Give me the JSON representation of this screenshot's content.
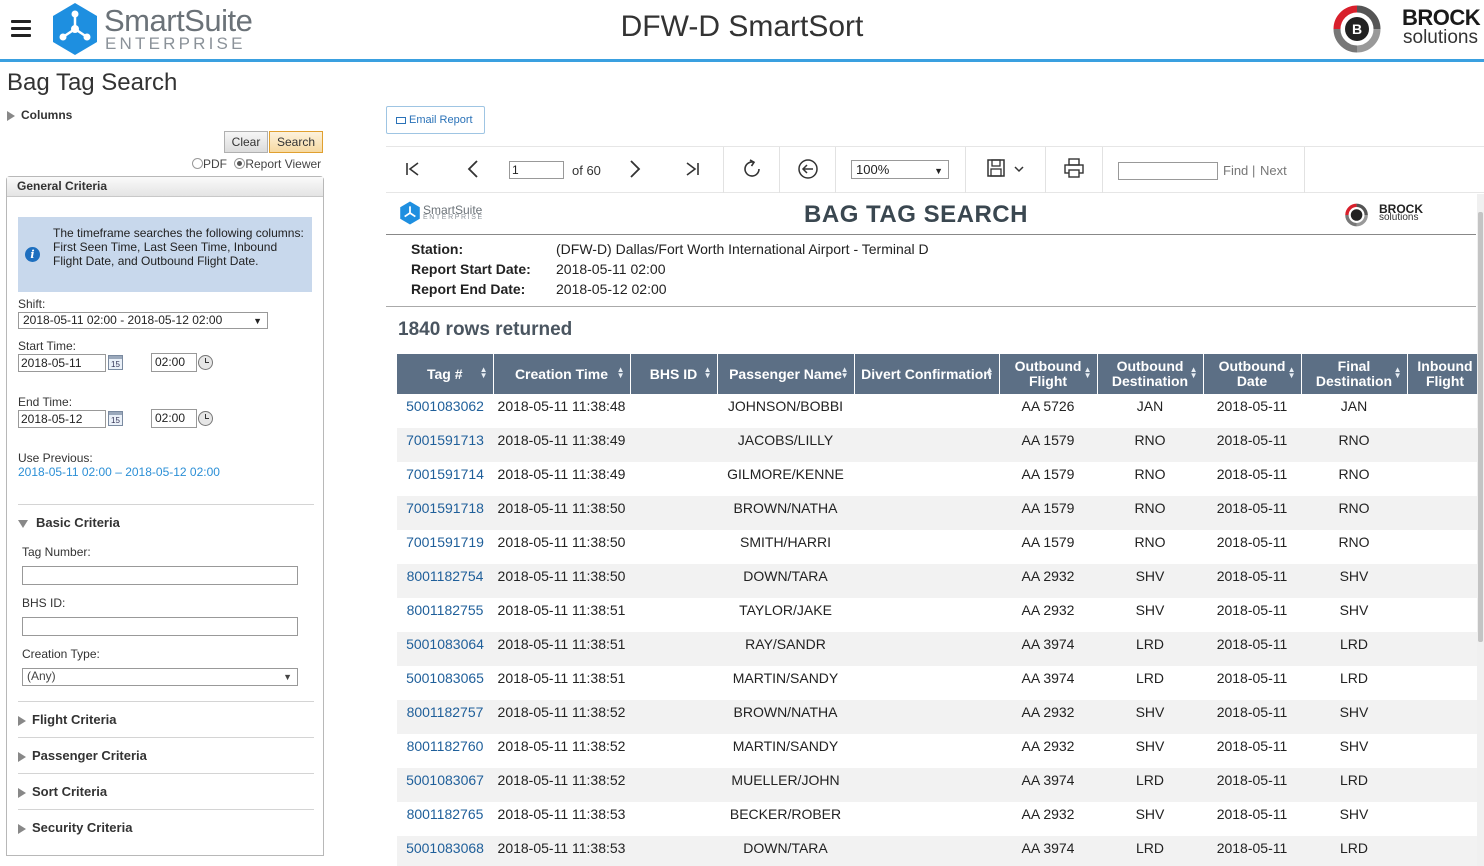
{
  "header": {
    "app_logo_name": "SmartSuite",
    "app_logo_sub": "ENTERPRISE",
    "title": "DFW-D SmartSort",
    "vendor_name": "BROCK",
    "vendor_sub": "solutions"
  },
  "sidebar": {
    "page_title": "Bag Tag Search",
    "columns_label": "Columns",
    "clear_label": "Clear",
    "search_label": "Search",
    "pdf_label": "PDF",
    "viewer_label": "Report Viewer",
    "output_selected": "Report Viewer",
    "general_criteria_label": "General Criteria",
    "info_text": "The timeframe searches the following columns: First Seen Time, Last Seen Time, Inbound Flight Date, and Outbound Flight Date.",
    "shift_label": "Shift:",
    "shift_value": "2018-05-11 02:00 - 2018-05-12 02:00",
    "start_time_label": "Start Time:",
    "start_date": "2018-05-11",
    "start_hour": "02:00",
    "end_time_label": "End Time:",
    "end_date": "2018-05-12",
    "end_hour": "02:00",
    "calendar_day": "15",
    "use_previous_label": "Use Previous:",
    "use_previous_link": "2018-05-11 02:00 – 2018-05-12 02:00",
    "basic_criteria_label": "Basic Criteria",
    "tag_number_label": "Tag Number:",
    "tag_number_value": "",
    "bhs_id_label": "BHS ID:",
    "bhs_id_value": "",
    "creation_type_label": "Creation Type:",
    "creation_type_value": "(Any)",
    "flight_criteria_label": "Flight Criteria",
    "passenger_criteria_label": "Passenger Criteria",
    "sort_criteria_label": "Sort Criteria",
    "security_criteria_label": "Security Criteria"
  },
  "viewer": {
    "email_label": "Email Report",
    "page_current": "1",
    "page_total_label": "of 60",
    "zoom": "100%",
    "find_value": "",
    "find_label": "Find",
    "find_sep": "|",
    "next_label": "Next"
  },
  "report": {
    "logo_name": "SmartSuite",
    "logo_sub": "ENTERPRISE",
    "title": "BAG TAG SEARCH",
    "brock_name": "BROCK",
    "brock_sub": "solutions",
    "station_key": "Station:",
    "station_val": "(DFW-D) Dallas/Fort Worth International Airport - Terminal D",
    "start_key": "Report Start Date:",
    "start_val": "2018-05-11 02:00",
    "end_key": "Report End Date:",
    "end_val": "2018-05-12 02:00",
    "rows_returned": "1840 rows returned",
    "columns": [
      "Tag #",
      "Creation Time",
      "BHS ID",
      "Passenger Name",
      "Divert Confirmation",
      "Outbound Flight",
      "Outbound Destination",
      "Outbound Date",
      "Final Destination",
      "Inbound Flight"
    ],
    "rows": [
      [
        "5001083062",
        "2018-05-11 11:38:48",
        "",
        "JOHNSON/BOBBI",
        "",
        "AA 5726",
        "JAN",
        "2018-05-11",
        "JAN",
        ""
      ],
      [
        "7001591713",
        "2018-05-11 11:38:49",
        "",
        "JACOBS/LILLY",
        "",
        "AA 1579",
        "RNO",
        "2018-05-11",
        "RNO",
        ""
      ],
      [
        "7001591714",
        "2018-05-11 11:38:49",
        "",
        "GILMORE/KENNE",
        "",
        "AA 1579",
        "RNO",
        "2018-05-11",
        "RNO",
        ""
      ],
      [
        "7001591718",
        "2018-05-11 11:38:50",
        "",
        "BROWN/NATHA",
        "",
        "AA 1579",
        "RNO",
        "2018-05-11",
        "RNO",
        ""
      ],
      [
        "7001591719",
        "2018-05-11 11:38:50",
        "",
        "SMITH/HARRI",
        "",
        "AA 1579",
        "RNO",
        "2018-05-11",
        "RNO",
        ""
      ],
      [
        "8001182754",
        "2018-05-11 11:38:50",
        "",
        "DOWN/TARA",
        "",
        "AA 2932",
        "SHV",
        "2018-05-11",
        "SHV",
        ""
      ],
      [
        "8001182755",
        "2018-05-11 11:38:51",
        "",
        "TAYLOR/JAKE",
        "",
        "AA 2932",
        "SHV",
        "2018-05-11",
        "SHV",
        ""
      ],
      [
        "5001083064",
        "2018-05-11 11:38:51",
        "",
        "RAY/SANDR",
        "",
        "AA 3974",
        "LRD",
        "2018-05-11",
        "LRD",
        ""
      ],
      [
        "5001083065",
        "2018-05-11 11:38:51",
        "",
        "MARTIN/SANDY",
        "",
        "AA 3974",
        "LRD",
        "2018-05-11",
        "LRD",
        ""
      ],
      [
        "8001182757",
        "2018-05-11 11:38:52",
        "",
        "BROWN/NATHA",
        "",
        "AA 2932",
        "SHV",
        "2018-05-11",
        "SHV",
        ""
      ],
      [
        "8001182760",
        "2018-05-11 11:38:52",
        "",
        "MARTIN/SANDY",
        "",
        "AA 2932",
        "SHV",
        "2018-05-11",
        "SHV",
        ""
      ],
      [
        "5001083067",
        "2018-05-11 11:38:52",
        "",
        "MUELLER/JOHN",
        "",
        "AA 3974",
        "LRD",
        "2018-05-11",
        "LRD",
        ""
      ],
      [
        "8001182765",
        "2018-05-11 11:38:53",
        "",
        "BECKER/ROBER",
        "",
        "AA 2932",
        "SHV",
        "2018-05-11",
        "SHV",
        ""
      ],
      [
        "5001083068",
        "2018-05-11 11:38:53",
        "",
        "DOWN/TARA",
        "",
        "AA 3974",
        "LRD",
        "2018-05-11",
        "LRD",
        ""
      ]
    ]
  },
  "colors": {
    "accent": "#3aa0e0",
    "table_header": "#5c6f85",
    "tag_link": "#1f5f9a",
    "info_bg": "#c8d8ec",
    "logo_blue": "#1e8fe0",
    "brock_red": "#d8202c"
  },
  "icons": {
    "menu": "hamburger-icon",
    "info": "info-icon",
    "calendar": "calendar-icon",
    "clock": "clock-icon",
    "email": "envelope-icon",
    "first": "first-page-icon",
    "prev": "previous-page-icon",
    "next": "next-page-icon",
    "last": "last-page-icon",
    "refresh": "refresh-icon",
    "back": "back-icon",
    "save": "save-icon",
    "print": "print-icon"
  }
}
